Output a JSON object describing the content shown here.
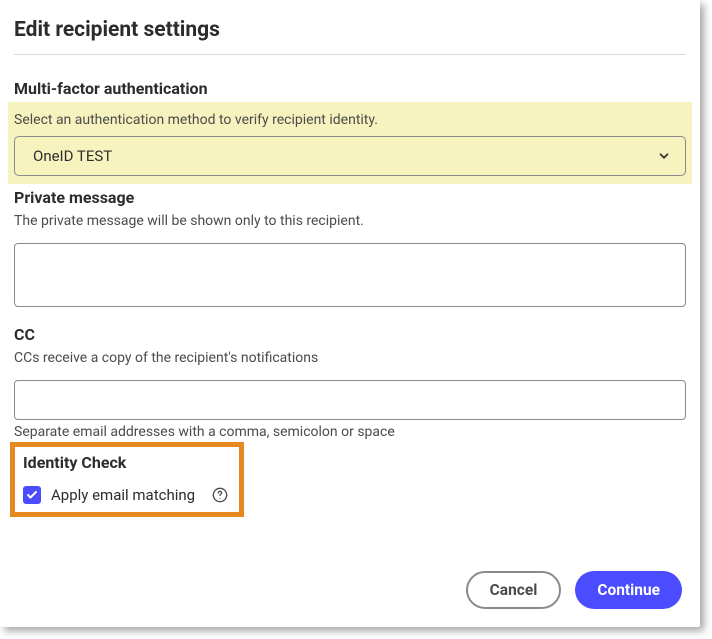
{
  "dialog": {
    "title": "Edit recipient settings"
  },
  "mfa": {
    "label": "Multi-factor authentication",
    "helper": "Select an authentication method to verify recipient identity.",
    "selected": "OneID TEST"
  },
  "privateMessage": {
    "label": "Private message",
    "helper": "The private message will be shown only to this recipient.",
    "value": ""
  },
  "cc": {
    "label": "CC",
    "helper": "CCs receive a copy of the recipient's notifications",
    "value": "",
    "caption": "Separate email addresses with a comma, semicolon or space"
  },
  "identityCheck": {
    "label": "Identity Check",
    "checkboxLabel": "Apply email matching",
    "checked": true
  },
  "footer": {
    "cancel": "Cancel",
    "continue": "Continue"
  }
}
